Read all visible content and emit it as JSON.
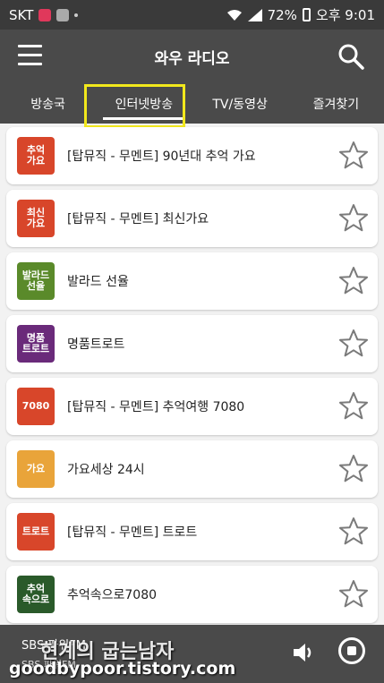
{
  "statusbar": {
    "carrier": "SKT",
    "battery": "72%",
    "time": "오후 9:01"
  },
  "header": {
    "title": "와우 라디오"
  },
  "tabs": [
    {
      "label": "방송국"
    },
    {
      "label": "인터넷방송"
    },
    {
      "label": "TV/동영상"
    },
    {
      "label": "즐겨찾기"
    }
  ],
  "stations": [
    {
      "name": "[탑뮤직 - 무멘트] 90년대 추억 가요",
      "thumb_text": "추억\n가요",
      "thumb_color": "#d8462a"
    },
    {
      "name": "[탑뮤직 - 무멘트] 최신가요",
      "thumb_text": "최신\n가요",
      "thumb_color": "#d8462a"
    },
    {
      "name": "발라드 선율",
      "thumb_text": "발라드\n선율",
      "thumb_color": "#5a8a2a"
    },
    {
      "name": "명품트로트",
      "thumb_text": "명품\n트로트",
      "thumb_color": "#6a2a7a"
    },
    {
      "name": "[탑뮤직 - 무멘트] 추억여행 7080",
      "thumb_text": "7080",
      "thumb_color": "#d8462a"
    },
    {
      "name": "가요세상 24시",
      "thumb_text": "가요",
      "thumb_color": "#e9a43a"
    },
    {
      "name": "[탑뮤직 - 무멘트] 트로트",
      "thumb_text": "트로트",
      "thumb_color": "#d8462a"
    },
    {
      "name": "추억속으로7080",
      "thumb_text": "추억\n속으로",
      "thumb_color": "#2a5a2a"
    }
  ],
  "player": {
    "now_playing": "SBS 파워FM",
    "sub": "SBS 파워FM"
  },
  "watermark": {
    "title": "현계의 굽는남자",
    "url": "goodbypoor.tistory.com"
  }
}
